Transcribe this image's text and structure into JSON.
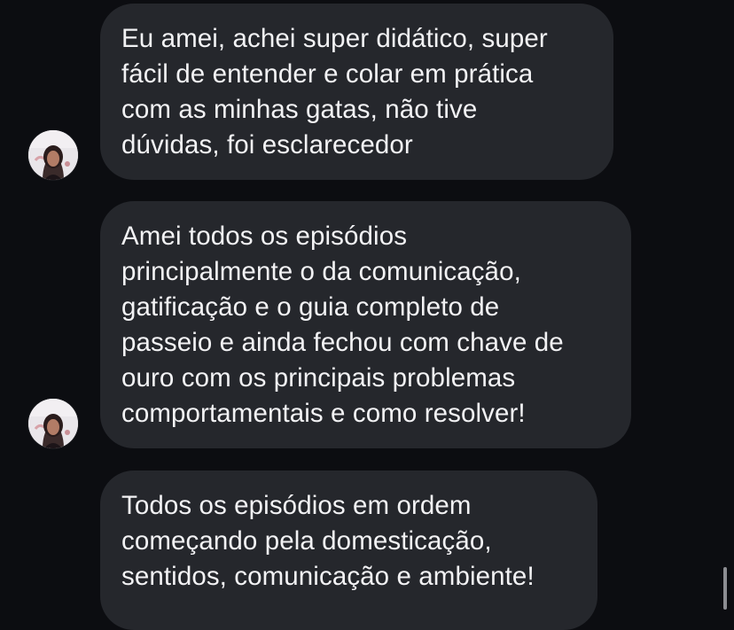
{
  "conversation": {
    "messages": [
      {
        "text": "Eu amei, achei super didático, super\nfácil de entender e colar em prática\ncom as minhas gatas, não tive\ndúvidas, foi esclarecedor",
        "has_avatar": true
      },
      {
        "text": "Amei todos os episódios\nprincipalmente o da comunicação,\ngatificação e o guia completo de\npasseio e ainda fechou com chave de\nouro com os principais problemas\ncomportamentais e como resolver!",
        "has_avatar": true
      },
      {
        "text": "Todos os episódios em ordem\ncomeçando pela domesticação,\nsentidos, comunicação e ambiente!",
        "has_avatar": false
      }
    ]
  },
  "icons": {
    "avatar": "sender-avatar-photo"
  },
  "colors": {
    "background": "#0c0d11",
    "bubble": "#25272c",
    "text": "#f2f2f4",
    "scrollbar": "#8c8d92"
  }
}
